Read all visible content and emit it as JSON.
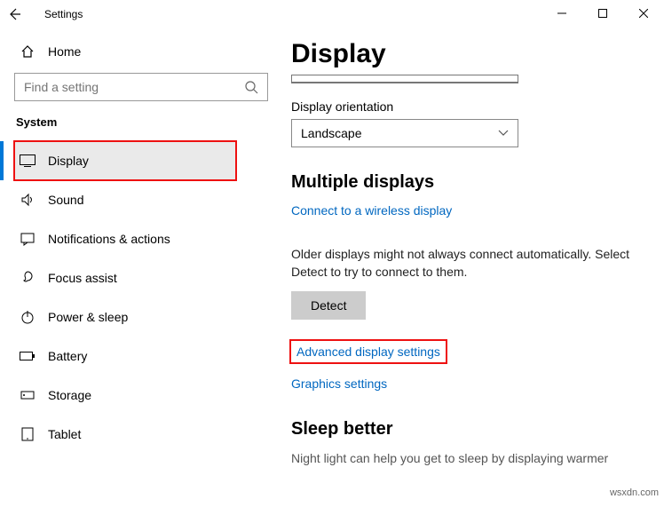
{
  "window": {
    "title": "Settings"
  },
  "side": {
    "home": "Home",
    "search_placeholder": "Find a setting",
    "section": "System",
    "items": [
      {
        "label": "Display",
        "selected": true,
        "highlighted": true
      },
      {
        "label": "Sound"
      },
      {
        "label": "Notifications & actions"
      },
      {
        "label": "Focus assist"
      },
      {
        "label": "Power & sleep"
      },
      {
        "label": "Battery"
      },
      {
        "label": "Storage"
      },
      {
        "label": "Tablet"
      }
    ]
  },
  "content": {
    "page_title": "Display",
    "orientation_label": "Display orientation",
    "orientation_value": "Landscape",
    "multiple_heading": "Multiple displays",
    "wireless_link": "Connect to a wireless display",
    "older_desc": "Older displays might not always connect automatically. Select Detect to try to connect to them.",
    "detect_button": "Detect",
    "advanced_link": "Advanced display settings",
    "graphics_link": "Graphics settings",
    "sleep_heading": "Sleep better",
    "sleep_desc": "Night light can help you get to sleep by displaying warmer"
  },
  "watermark": "wsxdn.com"
}
